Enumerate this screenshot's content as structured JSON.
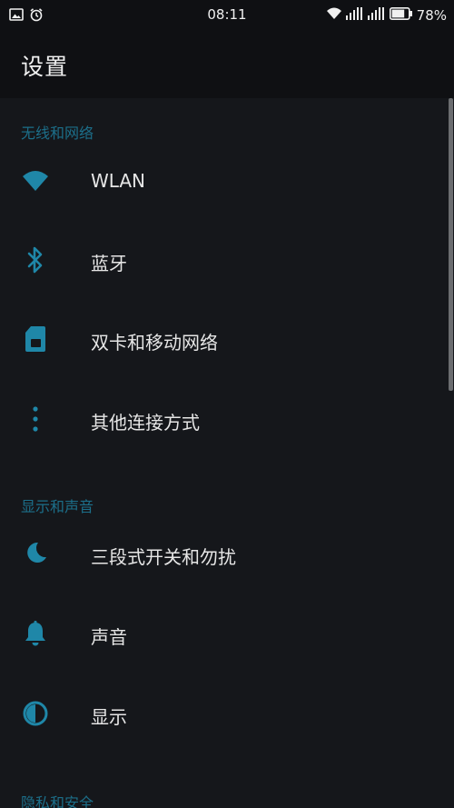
{
  "status_bar": {
    "time": "08:11",
    "battery_percent": "78%",
    "left_icons": [
      "image-icon",
      "alarm-icon"
    ],
    "right_icons": [
      "wifi-icon",
      "signal-icon-1",
      "signal-icon-2",
      "battery-icon"
    ],
    "battery_level": 0.78
  },
  "app_bar": {
    "title": "设置"
  },
  "sections": [
    {
      "header": "无线和网络",
      "items": [
        {
          "label": "WLAN",
          "icon": "wifi-icon"
        },
        {
          "label": "蓝牙",
          "icon": "bluetooth-icon"
        },
        {
          "label": "双卡和移动网络",
          "icon": "sim-card-icon"
        },
        {
          "label": "其他连接方式",
          "icon": "more-vert-icon"
        }
      ]
    },
    {
      "header": "显示和声音",
      "items": [
        {
          "label": "三段式开关和勿扰",
          "icon": "moon-icon"
        },
        {
          "label": "声音",
          "icon": "bell-icon"
        },
        {
          "label": "显示",
          "icon": "contrast-icon"
        }
      ]
    },
    {
      "header": "隐私和安全",
      "items": []
    }
  ],
  "colors": {
    "accent": "#1f87a8",
    "section_header": "#1c6f8a",
    "background": "#15171b",
    "bar_background": "#0f1013"
  }
}
